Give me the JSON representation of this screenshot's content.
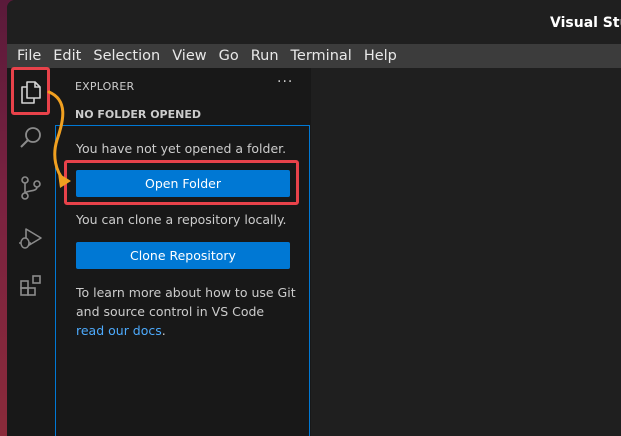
{
  "window": {
    "title": "Visual Stu"
  },
  "menu": [
    "File",
    "Edit",
    "Selection",
    "View",
    "Go",
    "Run",
    "Terminal",
    "Help"
  ],
  "activity_bar": {
    "icons": [
      "explorer-icon",
      "search-icon",
      "source-control-icon",
      "run-debug-icon",
      "extensions-icon"
    ]
  },
  "sidebar": {
    "title": "EXPLORER",
    "more": "···",
    "section": "NO FOLDER OPENED",
    "msg_not_opened": "You have not yet opened a folder.",
    "open_folder": "Open Folder",
    "msg_clone": "You can clone a repository locally.",
    "clone_repo": "Clone Repository",
    "docs_text": "To learn more about how to use Git and source control in VS Code ",
    "docs_link": "read our docs",
    "docs_end": "."
  },
  "colors": {
    "accent": "#0078d4",
    "highlight": "#e8424a",
    "arrow": "#f0a020",
    "link": "#4daafc"
  }
}
